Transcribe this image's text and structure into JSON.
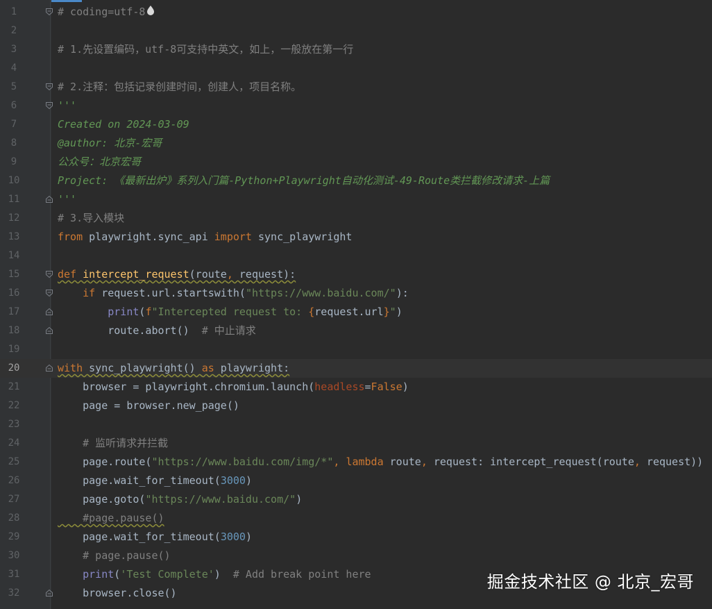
{
  "editor": {
    "current_line": 20,
    "lines": [
      {
        "n": "1",
        "t": "# coding=utf-8"
      },
      {
        "n": "2",
        "t": ""
      },
      {
        "n": "3",
        "t": "# 1.先设置编码，utf-8可支持中英文，如上，一般放在第一行"
      },
      {
        "n": "4",
        "t": ""
      },
      {
        "n": "5",
        "t": "# 2.注释：包括记录创建时间，创建人，项目名称。"
      },
      {
        "n": "6",
        "t": "'''"
      },
      {
        "n": "7",
        "t": "Created on 2024-03-09"
      },
      {
        "n": "8",
        "t": "@author: 北京-宏哥"
      },
      {
        "n": "9",
        "t": "公众号：北京宏哥"
      },
      {
        "n": "10",
        "t": "Project: 《最新出炉》系列入门篇-Python+Playwright自动化测试-49-Route类拦截修改请求-上篇"
      },
      {
        "n": "11",
        "t": "'''"
      },
      {
        "n": "12",
        "t": "# 3.导入模块"
      },
      {
        "n": "13",
        "t": "from playwright.sync_api import sync_playwright"
      },
      {
        "n": "14",
        "t": ""
      },
      {
        "n": "15",
        "t": "def intercept_request(route, request):"
      },
      {
        "n": "16",
        "t": "    if request.url.startswith(\"https://www.baidu.com/\"):"
      },
      {
        "n": "17",
        "t": "        print(f\"Intercepted request to: {request.url}\")"
      },
      {
        "n": "18",
        "t": "        route.abort()  # 中止请求"
      },
      {
        "n": "19",
        "t": ""
      },
      {
        "n": "20",
        "t": "with sync_playwright() as playwright:"
      },
      {
        "n": "21",
        "t": "    browser = playwright.chromium.launch(headless=False)"
      },
      {
        "n": "22",
        "t": "    page = browser.new_page()"
      },
      {
        "n": "23",
        "t": ""
      },
      {
        "n": "24",
        "t": "    # 监听请求并拦截"
      },
      {
        "n": "25",
        "t": "    page.route(\"https://www.baidu.com/img/*\", lambda route, request: intercept_request(route, request))"
      },
      {
        "n": "26",
        "t": "    page.wait_for_timeout(3000)"
      },
      {
        "n": "27",
        "t": "    page.goto(\"https://www.baidu.com/\")"
      },
      {
        "n": "28",
        "t": "    #page.pause()"
      },
      {
        "n": "29",
        "t": "    page.wait_for_timeout(3000)"
      },
      {
        "n": "30",
        "t": "    # page.pause()"
      },
      {
        "n": "31",
        "t": "    print('Test Complete')  # Add break point here"
      },
      {
        "n": "32",
        "t": "    browser.close()"
      }
    ]
  },
  "watermark": "掘金技术社区 @ 北京_宏哥",
  "colors": {
    "background": "#2b2b2b",
    "gutter": "#313335",
    "keyword": "#cc7832",
    "function": "#ffc66d",
    "string": "#6a8759",
    "comment": "#808080",
    "docstring": "#629755",
    "number": "#6897bb",
    "builtin": "#8888c6"
  },
  "icons": {
    "fold_open": "fold-open-icon",
    "fold_close": "fold-close-icon",
    "hint": "bulb-icon"
  }
}
